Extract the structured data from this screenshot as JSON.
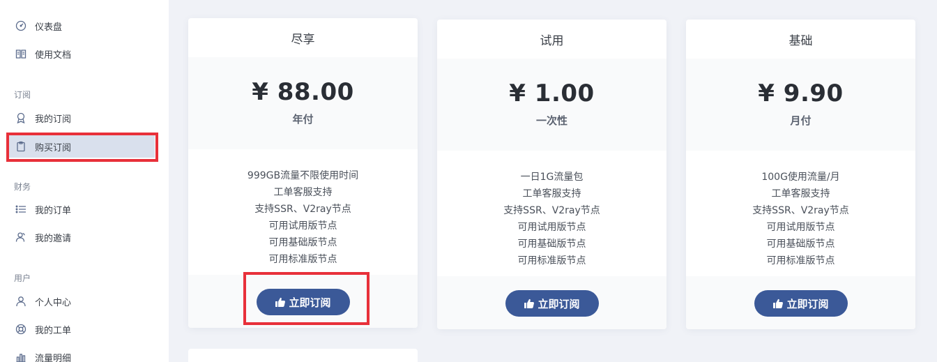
{
  "sidebar": {
    "items": [
      {
        "label": "仪表盘",
        "icon": "dashboard-icon"
      },
      {
        "label": "使用文档",
        "icon": "book-icon"
      }
    ],
    "sections": [
      {
        "label": "订阅",
        "items": [
          {
            "label": "我的订阅",
            "icon": "badge-icon"
          },
          {
            "label": "购买订阅",
            "icon": "clipboard-icon",
            "active": true
          }
        ]
      },
      {
        "label": "财务",
        "items": [
          {
            "label": "我的订单",
            "icon": "list-icon"
          },
          {
            "label": "我的邀请",
            "icon": "users-icon"
          }
        ]
      },
      {
        "label": "用户",
        "items": [
          {
            "label": "个人中心",
            "icon": "user-icon"
          },
          {
            "label": "我的工单",
            "icon": "lifebuoy-icon"
          },
          {
            "label": "流量明细",
            "icon": "bar-chart-icon"
          }
        ]
      }
    ]
  },
  "plans": [
    {
      "name": "尽享",
      "price": "¥ 88.00",
      "cycle": "年付",
      "features": [
        "999GB流量不限使用时间",
        "工单客服支持",
        "支持SSR、V2ray节点",
        "可用试用版节点",
        "可用基础版节点",
        "可用标准版节点"
      ],
      "button": "立即订阅"
    },
    {
      "name": "试用",
      "price": "¥ 1.00",
      "cycle": "一次性",
      "features": [
        "一日1G流量包",
        "工单客服支持",
        "支持SSR、V2ray节点",
        "可用试用版节点",
        "可用基础版节点",
        "可用标准版节点"
      ],
      "button": "立即订阅"
    },
    {
      "name": "基础",
      "price": "¥ 9.90",
      "cycle": "月付",
      "features": [
        "100G使用流量/月",
        "工单客服支持",
        "支持SSR、V2ray节点",
        "可用试用版节点",
        "可用基础版节点",
        "可用标准版节点"
      ],
      "button": "立即订阅"
    }
  ],
  "colors": {
    "accent": "#3b5998",
    "highlight": "#e8303a",
    "active_bg": "#d9e0ed",
    "page_bg": "#f0f2f7"
  }
}
